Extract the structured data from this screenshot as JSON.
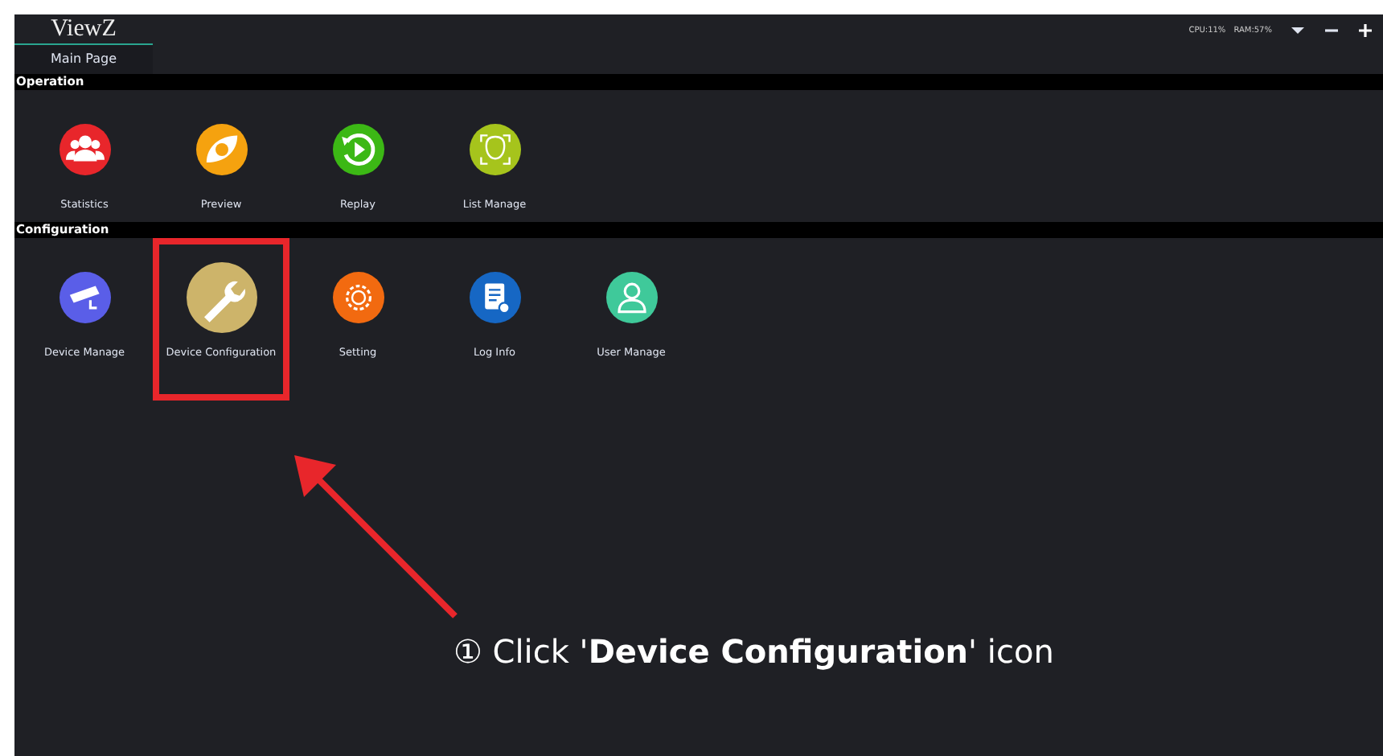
{
  "header": {
    "logo": "ViewZ",
    "tab": {
      "label": "Main Page",
      "selected": true
    },
    "stats": [
      "CPU:11%",
      "RAM:57%"
    ]
  },
  "sections": [
    {
      "title": "Operation",
      "items": [
        {
          "label": "Statistics",
          "kind": "people",
          "color": "#e8262b",
          "highlighted": false
        },
        {
          "label": "Preview",
          "kind": "eye",
          "color": "#f5a20f",
          "highlighted": false
        },
        {
          "label": "Replay",
          "kind": "replay",
          "color": "#3cb815",
          "highlighted": false
        },
        {
          "label": "List Manage",
          "kind": "face",
          "color": "#a6c41c",
          "highlighted": false
        }
      ]
    },
    {
      "title": "Configuration",
      "items": [
        {
          "label": "Device Manage",
          "kind": "camera",
          "color": "#5a5ee8",
          "highlighted": false
        },
        {
          "label": "Device Configuration",
          "kind": "wrench",
          "color": "#cdb46a",
          "highlighted": true
        },
        {
          "label": "Setting",
          "kind": "gear",
          "color": "#f26a10",
          "highlighted": false
        },
        {
          "label": "Log Info",
          "kind": "document",
          "color": "#1667c4",
          "highlighted": false
        },
        {
          "label": "User Manage",
          "kind": "user",
          "color": "#3fc99a",
          "highlighted": false
        }
      ]
    }
  ],
  "annotation": {
    "text": "① Click '**Device Configuration**' icon"
  }
}
